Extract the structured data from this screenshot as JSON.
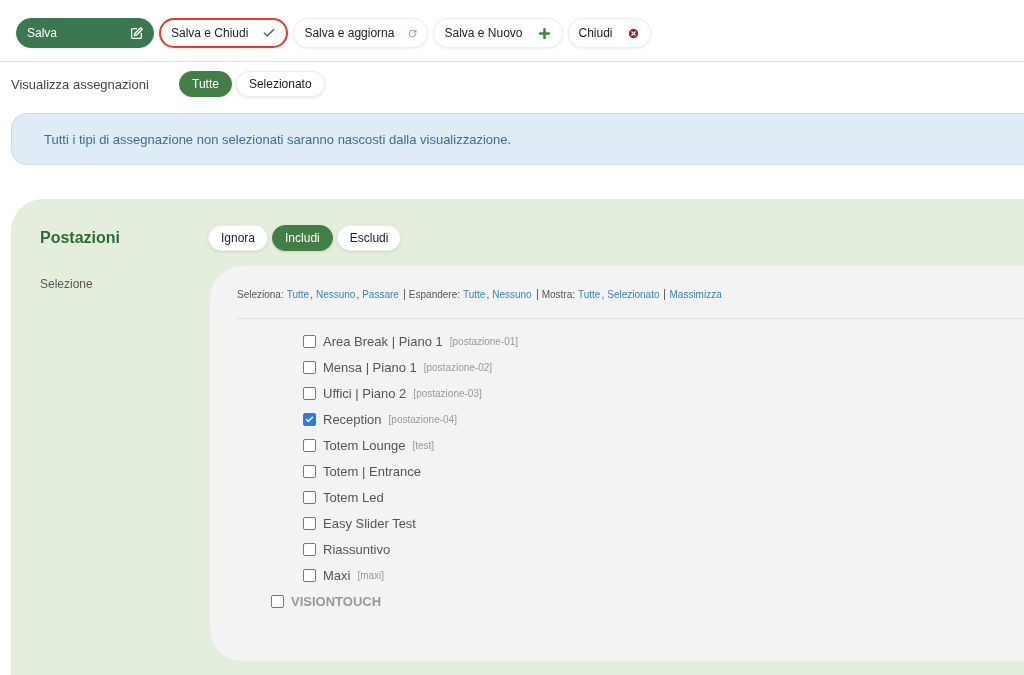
{
  "toolbar": [
    {
      "label": "Salva",
      "kind": "save",
      "focused": false
    },
    {
      "label": "Salva e Chiudi",
      "kind": "saveclose",
      "focused": true
    },
    {
      "label": "Salva e aggiorna",
      "kind": "saveupdate",
      "focused": false
    },
    {
      "label": "Salva e Nuovo",
      "kind": "savenew",
      "focused": false
    },
    {
      "label": "Chiudi",
      "kind": "close",
      "focused": false
    }
  ],
  "view": {
    "label": "Visualizza assegnazioni",
    "options": [
      {
        "label": "Tutte",
        "selected": true
      },
      {
        "label": "Selezionato",
        "selected": false
      }
    ]
  },
  "info": "Tutti i tipi di assegnazione non selezionati saranno nascosti dalla visualizzazione.",
  "section": {
    "title": "Postazioni",
    "modes": [
      {
        "label": "Ignora",
        "selected": false
      },
      {
        "label": "Includi",
        "selected": true
      },
      {
        "label": "Escludi",
        "selected": false
      }
    ],
    "selection_label": "Selezione",
    "actions": [
      {
        "label": "Seleziona:",
        "links": [
          "Tutte",
          "Nessuno",
          "Passare"
        ],
        "separator": ","
      },
      {
        "label": "Espandere:",
        "links": [
          "Tutte",
          "Nessuno"
        ],
        "separator": ","
      },
      {
        "label": "Mostra:",
        "links": [
          "Tutte",
          "Selezionato"
        ],
        "separator": ","
      },
      {
        "links": [
          "Massimizza"
        ]
      }
    ],
    "tree": [
      {
        "children": [
          {
            "label": "Area Break | Piano 1",
            "code": "[postazione-01]",
            "checked": false
          },
          {
            "label": "Mensa | Piano 1",
            "code": "[postazione-02]",
            "checked": false
          },
          {
            "label": "Uffici | Piano 2",
            "code": "[postazione-03]",
            "checked": false
          },
          {
            "label": "Reception",
            "code": "[postazione-04]",
            "checked": true
          },
          {
            "label": "Totem Lounge",
            "code": "[test]",
            "checked": false
          },
          {
            "label": "Totem | Entrance",
            "checked": false
          },
          {
            "label": "Totem Led",
            "checked": false
          },
          {
            "label": "Easy Slider Test",
            "checked": false
          },
          {
            "label": "Riassuntivo",
            "checked": false
          },
          {
            "label": "Maxi",
            "code": "[maxi]",
            "checked": false
          }
        ]
      },
      {
        "label": "VISIONTOUCH",
        "checked": false
      }
    ]
  }
}
